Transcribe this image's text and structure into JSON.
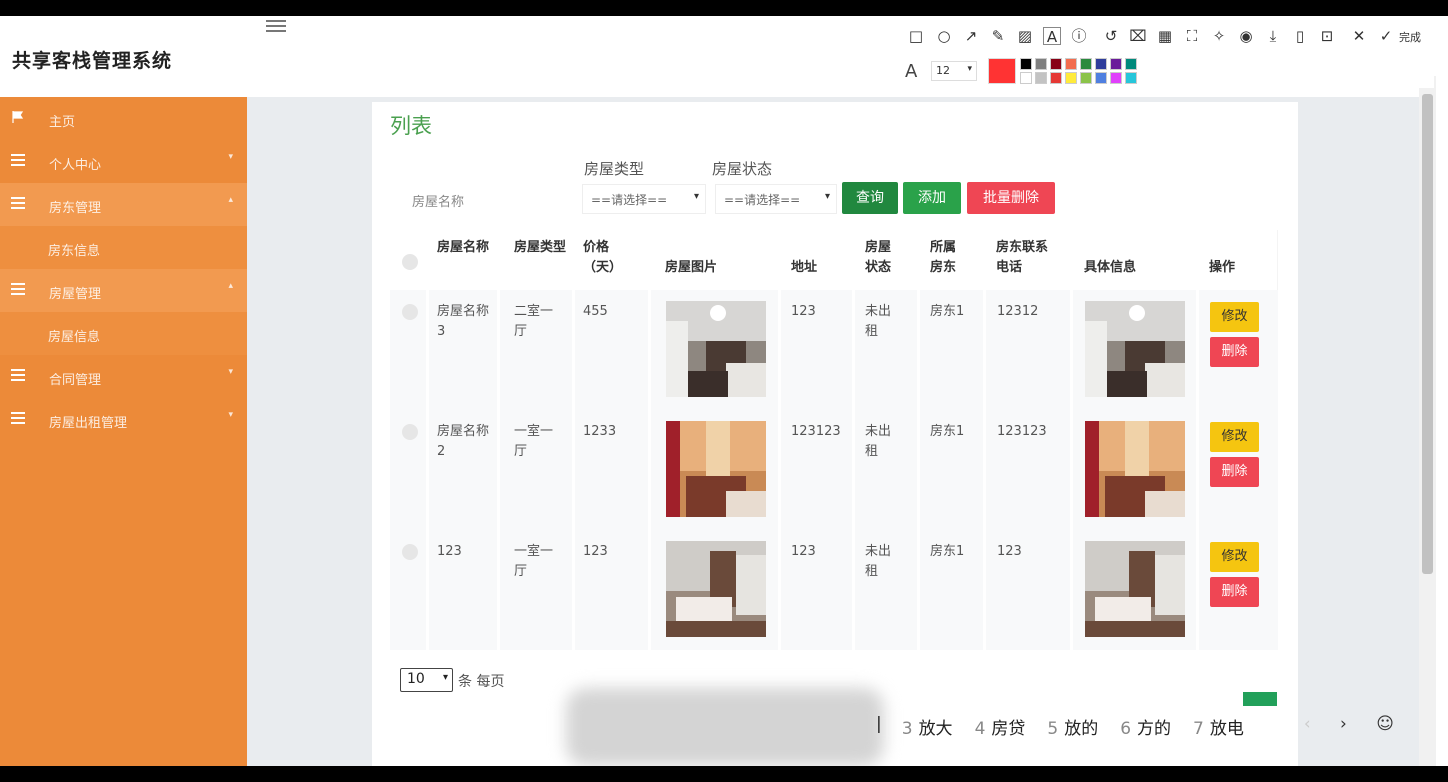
{
  "app": {
    "title": "共享客栈管理系统"
  },
  "sidebar": {
    "items": [
      {
        "label": "主页",
        "icon": "flag-icon",
        "expandable": false
      },
      {
        "label": "个人中心",
        "icon": "list-icon",
        "expandable": true
      },
      {
        "label": "房东管理",
        "icon": "list-icon",
        "expandable": true,
        "active": true,
        "sub": "房东信息"
      },
      {
        "label": "房屋管理",
        "icon": "list-icon",
        "expandable": true,
        "active": true,
        "sub": "房屋信息"
      },
      {
        "label": "合同管理",
        "icon": "list-icon",
        "expandable": true
      },
      {
        "label": "房屋出租管理",
        "icon": "list-icon",
        "expandable": true
      }
    ]
  },
  "panel": {
    "title": "列表",
    "filters": {
      "name_label": "房屋名称",
      "type_label": "房屋类型",
      "status_label": "房屋状态",
      "type_value": "==请选择==",
      "status_value": "==请选择=="
    },
    "buttons": {
      "search": "查询",
      "add": "添加",
      "batch_delete": "批量删除"
    },
    "table": {
      "headers": [
        "房屋名称",
        "房屋类型",
        "价格（天）",
        "房屋图片",
        "地址",
        "房屋状态",
        "所属房东",
        "房东联系电话",
        "具体信息",
        "操作"
      ],
      "rows": [
        {
          "name": "房屋名称3",
          "type": "二室一厅",
          "price": "455",
          "address": "123",
          "status": "未出租",
          "owner": "房东1",
          "phone": "12312"
        },
        {
          "name": "房屋名称2",
          "type": "一室一厅",
          "price": "1233",
          "address": "123123",
          "status": "未出租",
          "owner": "房东1",
          "phone": "123123"
        },
        {
          "name": "123",
          "type": "一室一厅",
          "price": "123",
          "address": "123",
          "status": "未出租",
          "owner": "房东1",
          "phone": "123"
        }
      ],
      "edit_label": "修改",
      "delete_label": "删除"
    },
    "pagination": {
      "page_size": "10",
      "per_page_label": "条 每页"
    }
  },
  "snip_toolbar": {
    "done_label": "完成",
    "font_size": "12",
    "current_color": "#ff3333",
    "swatches": [
      "#000000",
      "#7f7f7f",
      "#880015",
      "#f26d4f",
      "#2b8a3e",
      "#2f3d9b",
      "#6a1b9a",
      "#00897b",
      "#ffffff",
      "#c3c3c3",
      "#e53935",
      "#ffeb3b",
      "#8bc34a",
      "#4f7fe0",
      "#e040fb",
      "#26c6da"
    ]
  },
  "ime": {
    "candidates": [
      {
        "num": "3",
        "text": "放大"
      },
      {
        "num": "4",
        "text": "房贷"
      },
      {
        "num": "5",
        "text": "放的"
      },
      {
        "num": "6",
        "text": "方的"
      },
      {
        "num": "7",
        "text": "放电"
      }
    ]
  }
}
